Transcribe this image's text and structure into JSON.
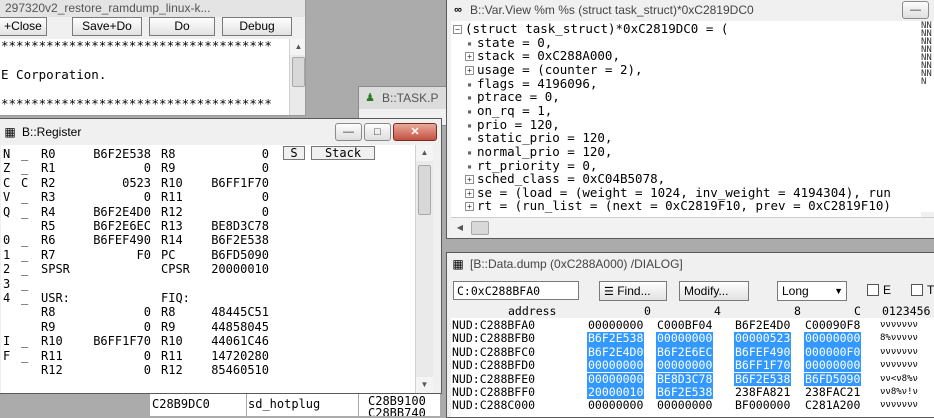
{
  "source_window": {
    "title": "297320v2_restore_ramdump_linux-k...",
    "toolbar": [
      "+Close",
      "Save+Do",
      "Do",
      "Debug"
    ],
    "lines": [
      "************************************",
      "",
      "E Corporation.",
      "",
      "************************************"
    ]
  },
  "task_window": {
    "title": "B::TASK.P"
  },
  "bottom_list": {
    "left": "C28B9DC0",
    "middle": "sd_hotplug",
    "right_top": "C28B9100",
    "right_bottom": "C28BB740"
  },
  "register_window": {
    "title": "B::Register",
    "buttons": {
      "s": "S",
      "stack": "Stack"
    },
    "rows": [
      {
        "f": "N",
        "fv": "_",
        "a": "R0",
        "av": "B6F2E538",
        "b": "R8",
        "bv": "0"
      },
      {
        "f": "Z",
        "fv": "_",
        "a": "R1",
        "av": "0",
        "b": "R9",
        "bv": "0"
      },
      {
        "f": "C",
        "fv": "C",
        "a": "R2",
        "av": "0523",
        "b": "R10",
        "bv": "B6FF1F70"
      },
      {
        "f": "V",
        "fv": "_",
        "a": "R3",
        "av": "0",
        "b": "R11",
        "bv": "0"
      },
      {
        "f": "Q",
        "fv": "_",
        "a": "R4",
        "av": "B6F2E4D0",
        "b": "R12",
        "bv": "0"
      },
      {
        "f": "",
        "fv": "",
        "a": "R5",
        "av": "B6F2E6EC",
        "b": "R13",
        "bv": "BE8D3C78"
      },
      {
        "f": "0",
        "fv": "_",
        "a": "R6",
        "av": "B6FEF490",
        "b": "R14",
        "bv": "B6F2E538"
      },
      {
        "f": "1",
        "fv": "_",
        "a": "R7",
        "av": "F0",
        "b": "PC",
        "bv": "B6FD5090"
      },
      {
        "f": "2",
        "fv": "_",
        "a": "SPSR",
        "av": "",
        "b": "CPSR",
        "bv": "20000010"
      },
      {
        "f": "3",
        "fv": "_",
        "a": "",
        "av": "",
        "b": "",
        "bv": ""
      },
      {
        "f": "4",
        "fv": "_",
        "a": "USR:",
        "av": "",
        "b": "FIQ:",
        "bv": ""
      },
      {
        "f": "",
        "fv": "",
        "a": "R8",
        "av": "0",
        "b": "R8",
        "bv": "48445C51"
      },
      {
        "f": "",
        "fv": "",
        "a": "R9",
        "av": "0",
        "b": "R9",
        "bv": "44858045"
      },
      {
        "f": "I",
        "fv": "_",
        "a": "R10",
        "av": "B6FF1F70",
        "b": "R10",
        "bv": "44061C46"
      },
      {
        "f": "F",
        "fv": "_",
        "a": "R11",
        "av": "0",
        "b": "R11",
        "bv": "14720280"
      },
      {
        "f": "",
        "fv": "",
        "a": "R12",
        "av": "0",
        "b": "R12",
        "bv": "85460510"
      }
    ]
  },
  "varview_window": {
    "title": "B::Var.View %m %s (struct task_struct)*0xC2819DC0",
    "lines": [
      {
        "kind": "minus",
        "text": "(struct task_struct)*0xC2819DC0 = ("
      },
      {
        "kind": "dot",
        "text": "state = 0,"
      },
      {
        "kind": "plus",
        "text": "stack = 0xC288A000,"
      },
      {
        "kind": "plus",
        "text": "usage = (counter = 2),"
      },
      {
        "kind": "dot",
        "text": "flags = 4196096,"
      },
      {
        "kind": "dot",
        "text": "ptrace = 0,"
      },
      {
        "kind": "dot",
        "text": "on_rq = 1,"
      },
      {
        "kind": "dot",
        "text": "prio = 120,"
      },
      {
        "kind": "dot",
        "text": "static_prio = 120,"
      },
      {
        "kind": "dot",
        "text": "normal_prio = 120,"
      },
      {
        "kind": "dot",
        "text": "rt_priority = 0,"
      },
      {
        "kind": "plus",
        "text": "sched_class = 0xC04B5078,"
      },
      {
        "kind": "plus",
        "text": "se = (load = (weight = 1024, inv_weight = 4194304), run"
      },
      {
        "kind": "plus",
        "text": "rt = (run_list = (next = 0xC2819F10, prev = 0xC2819F10)"
      }
    ],
    "right_column": "NNNNNNNNNNNNNNN"
  },
  "dump_window": {
    "title": "[B::Data.dump (0xC288A000) /DIALOG]",
    "address_input": "C:0xC288BFA0",
    "find_label": "Find...",
    "modify_label": "Modify...",
    "format_select": "Long",
    "checkbox_e": "E",
    "checkbox_t": "T",
    "columns": [
      "address",
      "0",
      "4",
      "8",
      "C",
      "0123456"
    ],
    "rows": [
      {
        "addr": "NUD:C288BFA0",
        "v": [
          "00000000",
          "C000BF04",
          "B6F2E4D0",
          "C00090F8"
        ],
        "sel": [
          false,
          false,
          false,
          false
        ],
        "ascii": "ννννννν"
      },
      {
        "addr": "NUD:C288BFB0",
        "v": [
          "B6F2E538",
          "00000000",
          "00000523",
          "00000000"
        ],
        "sel": [
          true,
          true,
          true,
          true
        ],
        "ascii": "8%ννννν"
      },
      {
        "addr": "NUD:C288BFC0",
        "v": [
          "B6F2E4D0",
          "B6F2E6EC",
          "B6FEF490",
          "000000F0"
        ],
        "sel": [
          true,
          true,
          true,
          true
        ],
        "ascii": "ννννννν"
      },
      {
        "addr": "NUD:C288BFD0",
        "v": [
          "00000000",
          "00000000",
          "B6FF1F70",
          "00000000"
        ],
        "sel": [
          true,
          true,
          true,
          true
        ],
        "ascii": "ννννννν"
      },
      {
        "addr": "NUD:C288BFE0",
        "v": [
          "00000000",
          "BE8D3C78",
          "B6F2E538",
          "B6FD5090"
        ],
        "sel": [
          true,
          true,
          true,
          true
        ],
        "ascii": "νν<ν8%ν"
      },
      {
        "addr": "NUD:C288BFF0",
        "v": [
          "20000010",
          "B6F2E538",
          "238FA821",
          "238FAC21"
        ],
        "sel": [
          true,
          true,
          false,
          false
        ],
        "ascii": "νν8%ν!ν"
      },
      {
        "addr": "NUD:C288C000",
        "v": [
          "00000000",
          "00000000",
          "BF000000",
          "C281A200"
        ],
        "sel": [
          false,
          false,
          false,
          false
        ],
        "ascii": "ννννννν"
      }
    ]
  }
}
